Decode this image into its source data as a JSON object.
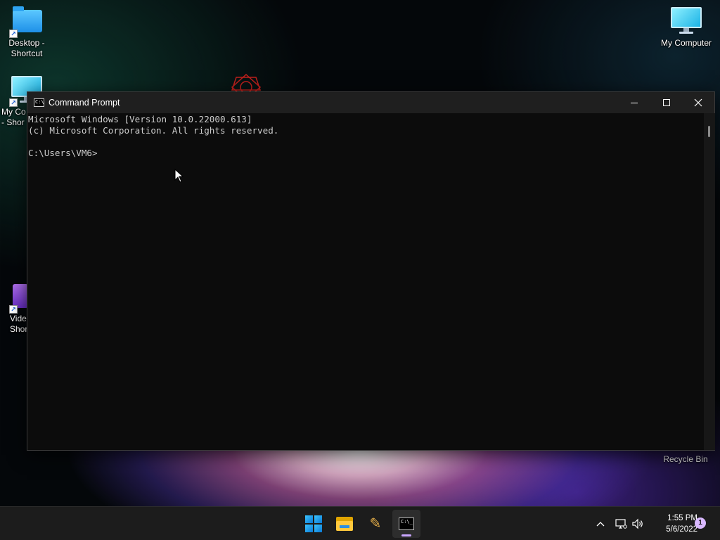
{
  "desktop": {
    "icons": [
      {
        "label": "Desktop -\nShortcut",
        "icon": "folder-icon"
      },
      {
        "label": "My Co\n- Shor",
        "icon": "monitor-icon"
      },
      {
        "label": "Vide\nShor",
        "icon": "video-icon"
      },
      {
        "label": "My Computer",
        "icon": "monitor-icon"
      }
    ],
    "recycle_bin_label": "Recycle Bin"
  },
  "window": {
    "title": "Command Prompt",
    "controls": {
      "minimize": "minimize-icon",
      "maximize": "maximize-icon",
      "close": "close-icon"
    },
    "console_lines": [
      "Microsoft Windows [Version 10.0.22000.613]",
      "(c) Microsoft Corporation. All rights reserved.",
      "",
      "C:\\Users\\VM6>"
    ]
  },
  "taskbar": {
    "apps": [
      {
        "name": "start",
        "icon": "windows-logo-icon"
      },
      {
        "name": "file-explorer",
        "icon": "folder-icon"
      },
      {
        "name": "tools",
        "icon": "tools-icon"
      },
      {
        "name": "command-prompt",
        "icon": "terminal-icon",
        "active": true
      }
    ],
    "tray": {
      "chevron": "chevron-up-icon",
      "network": "network-icon",
      "volume": "speaker-icon",
      "time": "1:55 PM",
      "date": "5/6/2022",
      "notification_count": "1"
    }
  },
  "colors": {
    "console_bg": "#0c0c0c",
    "console_fg": "#cccccc",
    "titlebar_bg": "#1f1f1f",
    "taskbar_bg": "#1c1c1c",
    "accent": "#c9a6ff"
  }
}
